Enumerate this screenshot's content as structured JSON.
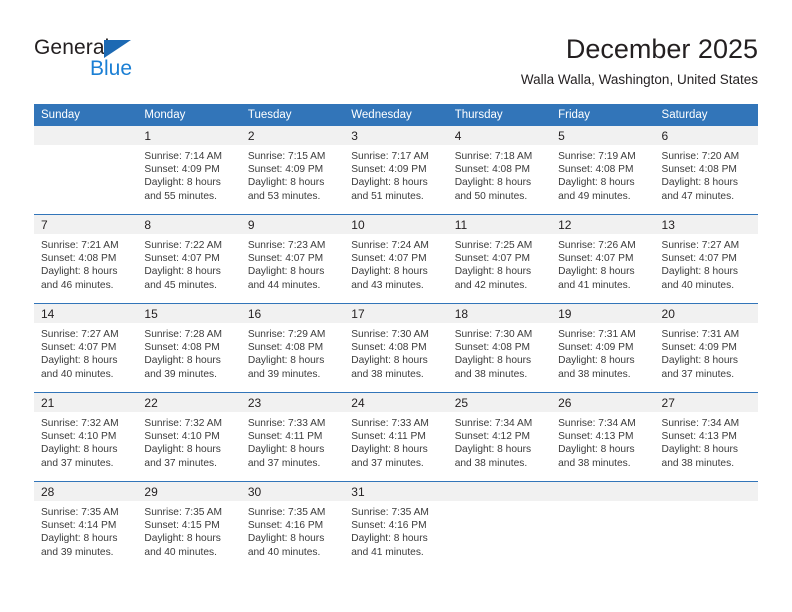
{
  "brand": {
    "name_top": "General",
    "name_bottom": "Blue",
    "accent_color": "#1c69b3",
    "blue_text_color": "#1b7fd4"
  },
  "header": {
    "month_title": "December 2025",
    "location": "Walla Walla, Washington, United States"
  },
  "calendar": {
    "header_bg": "#3275b9",
    "daynum_bg": "#f1f1f1",
    "weekday_headers": [
      "Sunday",
      "Monday",
      "Tuesday",
      "Wednesday",
      "Thursday",
      "Friday",
      "Saturday"
    ],
    "weeks": [
      [
        {
          "day": ""
        },
        {
          "day": "1",
          "sunrise": "Sunrise: 7:14 AM",
          "sunset": "Sunset: 4:09 PM",
          "daylight_1": "Daylight: 8 hours",
          "daylight_2": "and 55 minutes."
        },
        {
          "day": "2",
          "sunrise": "Sunrise: 7:15 AM",
          "sunset": "Sunset: 4:09 PM",
          "daylight_1": "Daylight: 8 hours",
          "daylight_2": "and 53 minutes."
        },
        {
          "day": "3",
          "sunrise": "Sunrise: 7:17 AM",
          "sunset": "Sunset: 4:09 PM",
          "daylight_1": "Daylight: 8 hours",
          "daylight_2": "and 51 minutes."
        },
        {
          "day": "4",
          "sunrise": "Sunrise: 7:18 AM",
          "sunset": "Sunset: 4:08 PM",
          "daylight_1": "Daylight: 8 hours",
          "daylight_2": "and 50 minutes."
        },
        {
          "day": "5",
          "sunrise": "Sunrise: 7:19 AM",
          "sunset": "Sunset: 4:08 PM",
          "daylight_1": "Daylight: 8 hours",
          "daylight_2": "and 49 minutes."
        },
        {
          "day": "6",
          "sunrise": "Sunrise: 7:20 AM",
          "sunset": "Sunset: 4:08 PM",
          "daylight_1": "Daylight: 8 hours",
          "daylight_2": "and 47 minutes."
        }
      ],
      [
        {
          "day": "7",
          "sunrise": "Sunrise: 7:21 AM",
          "sunset": "Sunset: 4:08 PM",
          "daylight_1": "Daylight: 8 hours",
          "daylight_2": "and 46 minutes."
        },
        {
          "day": "8",
          "sunrise": "Sunrise: 7:22 AM",
          "sunset": "Sunset: 4:07 PM",
          "daylight_1": "Daylight: 8 hours",
          "daylight_2": "and 45 minutes."
        },
        {
          "day": "9",
          "sunrise": "Sunrise: 7:23 AM",
          "sunset": "Sunset: 4:07 PM",
          "daylight_1": "Daylight: 8 hours",
          "daylight_2": "and 44 minutes."
        },
        {
          "day": "10",
          "sunrise": "Sunrise: 7:24 AM",
          "sunset": "Sunset: 4:07 PM",
          "daylight_1": "Daylight: 8 hours",
          "daylight_2": "and 43 minutes."
        },
        {
          "day": "11",
          "sunrise": "Sunrise: 7:25 AM",
          "sunset": "Sunset: 4:07 PM",
          "daylight_1": "Daylight: 8 hours",
          "daylight_2": "and 42 minutes."
        },
        {
          "day": "12",
          "sunrise": "Sunrise: 7:26 AM",
          "sunset": "Sunset: 4:07 PM",
          "daylight_1": "Daylight: 8 hours",
          "daylight_2": "and 41 minutes."
        },
        {
          "day": "13",
          "sunrise": "Sunrise: 7:27 AM",
          "sunset": "Sunset: 4:07 PM",
          "daylight_1": "Daylight: 8 hours",
          "daylight_2": "and 40 minutes."
        }
      ],
      [
        {
          "day": "14",
          "sunrise": "Sunrise: 7:27 AM",
          "sunset": "Sunset: 4:07 PM",
          "daylight_1": "Daylight: 8 hours",
          "daylight_2": "and 40 minutes."
        },
        {
          "day": "15",
          "sunrise": "Sunrise: 7:28 AM",
          "sunset": "Sunset: 4:08 PM",
          "daylight_1": "Daylight: 8 hours",
          "daylight_2": "and 39 minutes."
        },
        {
          "day": "16",
          "sunrise": "Sunrise: 7:29 AM",
          "sunset": "Sunset: 4:08 PM",
          "daylight_1": "Daylight: 8 hours",
          "daylight_2": "and 39 minutes."
        },
        {
          "day": "17",
          "sunrise": "Sunrise: 7:30 AM",
          "sunset": "Sunset: 4:08 PM",
          "daylight_1": "Daylight: 8 hours",
          "daylight_2": "and 38 minutes."
        },
        {
          "day": "18",
          "sunrise": "Sunrise: 7:30 AM",
          "sunset": "Sunset: 4:08 PM",
          "daylight_1": "Daylight: 8 hours",
          "daylight_2": "and 38 minutes."
        },
        {
          "day": "19",
          "sunrise": "Sunrise: 7:31 AM",
          "sunset": "Sunset: 4:09 PM",
          "daylight_1": "Daylight: 8 hours",
          "daylight_2": "and 38 minutes."
        },
        {
          "day": "20",
          "sunrise": "Sunrise: 7:31 AM",
          "sunset": "Sunset: 4:09 PM",
          "daylight_1": "Daylight: 8 hours",
          "daylight_2": "and 37 minutes."
        }
      ],
      [
        {
          "day": "21",
          "sunrise": "Sunrise: 7:32 AM",
          "sunset": "Sunset: 4:10 PM",
          "daylight_1": "Daylight: 8 hours",
          "daylight_2": "and 37 minutes."
        },
        {
          "day": "22",
          "sunrise": "Sunrise: 7:32 AM",
          "sunset": "Sunset: 4:10 PM",
          "daylight_1": "Daylight: 8 hours",
          "daylight_2": "and 37 minutes."
        },
        {
          "day": "23",
          "sunrise": "Sunrise: 7:33 AM",
          "sunset": "Sunset: 4:11 PM",
          "daylight_1": "Daylight: 8 hours",
          "daylight_2": "and 37 minutes."
        },
        {
          "day": "24",
          "sunrise": "Sunrise: 7:33 AM",
          "sunset": "Sunset: 4:11 PM",
          "daylight_1": "Daylight: 8 hours",
          "daylight_2": "and 37 minutes."
        },
        {
          "day": "25",
          "sunrise": "Sunrise: 7:34 AM",
          "sunset": "Sunset: 4:12 PM",
          "daylight_1": "Daylight: 8 hours",
          "daylight_2": "and 38 minutes."
        },
        {
          "day": "26",
          "sunrise": "Sunrise: 7:34 AM",
          "sunset": "Sunset: 4:13 PM",
          "daylight_1": "Daylight: 8 hours",
          "daylight_2": "and 38 minutes."
        },
        {
          "day": "27",
          "sunrise": "Sunrise: 7:34 AM",
          "sunset": "Sunset: 4:13 PM",
          "daylight_1": "Daylight: 8 hours",
          "daylight_2": "and 38 minutes."
        }
      ],
      [
        {
          "day": "28",
          "sunrise": "Sunrise: 7:35 AM",
          "sunset": "Sunset: 4:14 PM",
          "daylight_1": "Daylight: 8 hours",
          "daylight_2": "and 39 minutes."
        },
        {
          "day": "29",
          "sunrise": "Sunrise: 7:35 AM",
          "sunset": "Sunset: 4:15 PM",
          "daylight_1": "Daylight: 8 hours",
          "daylight_2": "and 40 minutes."
        },
        {
          "day": "30",
          "sunrise": "Sunrise: 7:35 AM",
          "sunset": "Sunset: 4:16 PM",
          "daylight_1": "Daylight: 8 hours",
          "daylight_2": "and 40 minutes."
        },
        {
          "day": "31",
          "sunrise": "Sunrise: 7:35 AM",
          "sunset": "Sunset: 4:16 PM",
          "daylight_1": "Daylight: 8 hours",
          "daylight_2": "and 41 minutes."
        },
        {
          "day": ""
        },
        {
          "day": ""
        },
        {
          "day": ""
        }
      ]
    ]
  }
}
